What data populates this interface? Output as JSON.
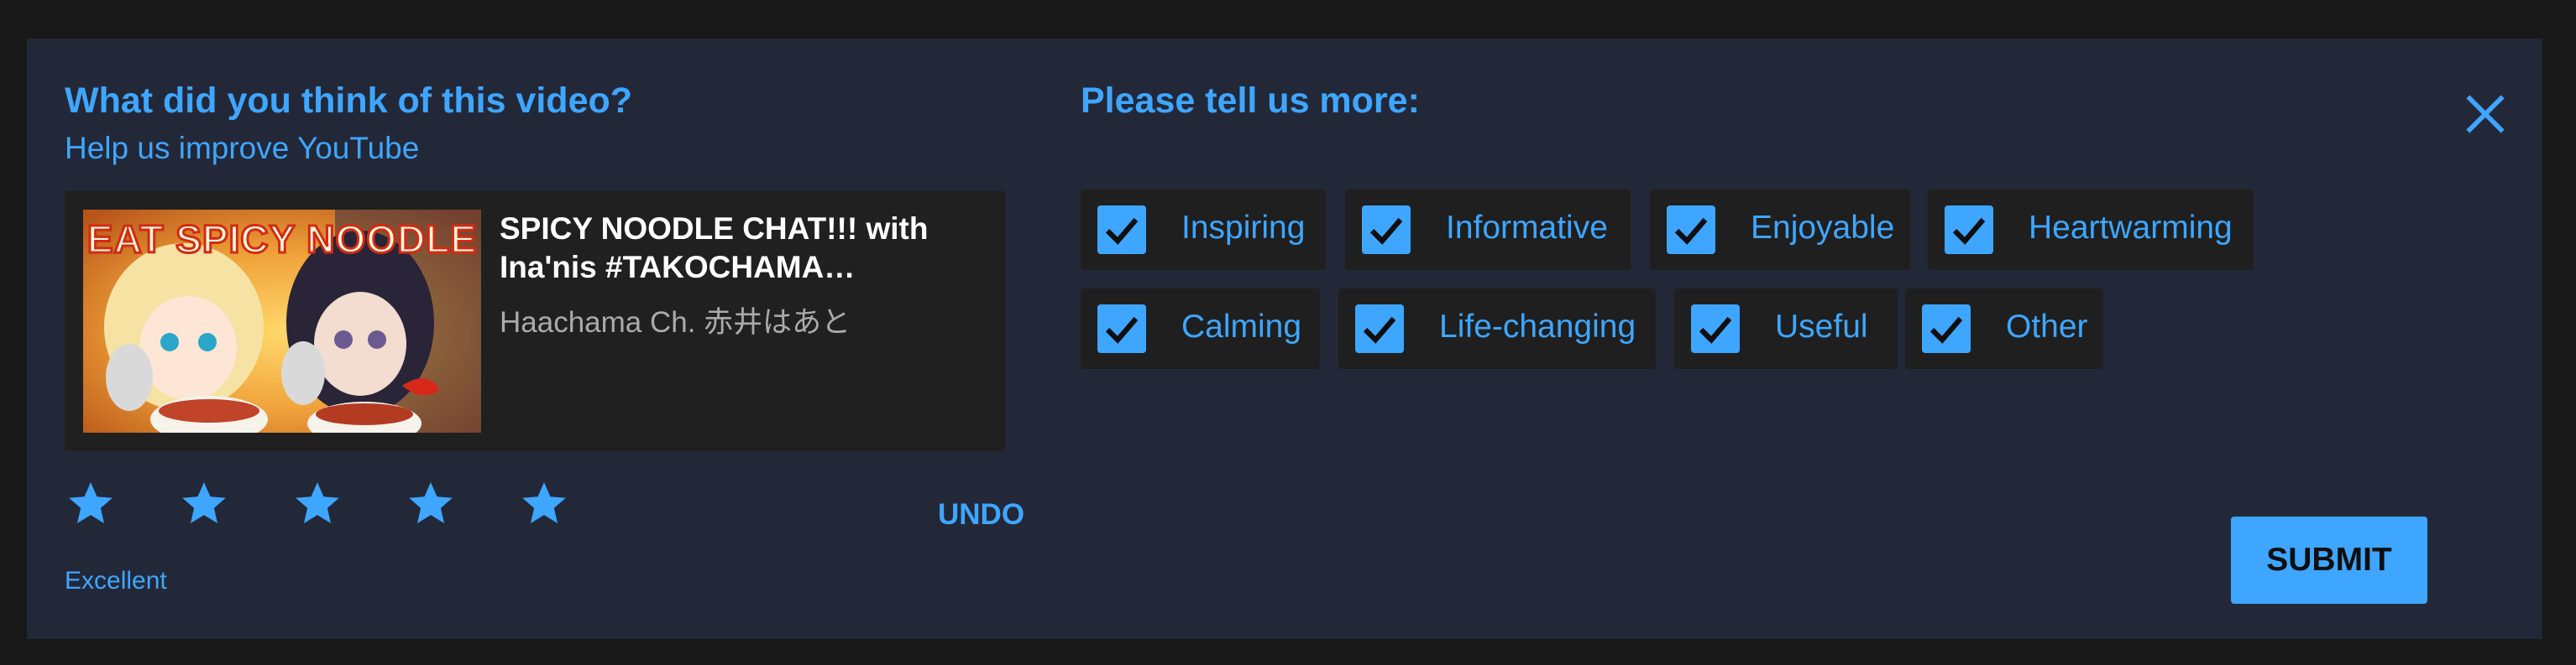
{
  "colors": {
    "accent": "#3ea6ff",
    "panel": "#232838",
    "page": "#181818",
    "chip": "#1f1f1f"
  },
  "left": {
    "title": "What did you think of this video?",
    "subtitle": "Help us improve YouTube"
  },
  "video": {
    "thumbnail_text": "EAT SPICY NOODLE",
    "title": "SPICY NOODLE CHAT!!! with Ina'nis #TAKOCHAMA…",
    "channel": "Haachama Ch. 赤井はあと"
  },
  "rating": {
    "stars": 5,
    "max": 5,
    "label": "Excellent",
    "undo_label": "UNDO"
  },
  "right": {
    "title": "Please tell us more:",
    "close_icon": "close-icon",
    "options": [
      {
        "label": "Inspiring",
        "checked": true
      },
      {
        "label": "Informative",
        "checked": true
      },
      {
        "label": "Enjoyable",
        "checked": true
      },
      {
        "label": "Heartwarming",
        "checked": true
      },
      {
        "label": "Calming",
        "checked": true
      },
      {
        "label": "Life-changing",
        "checked": true
      },
      {
        "label": "Useful",
        "checked": true
      },
      {
        "label": "Other",
        "checked": true
      }
    ],
    "submit_label": "SUBMIT"
  }
}
